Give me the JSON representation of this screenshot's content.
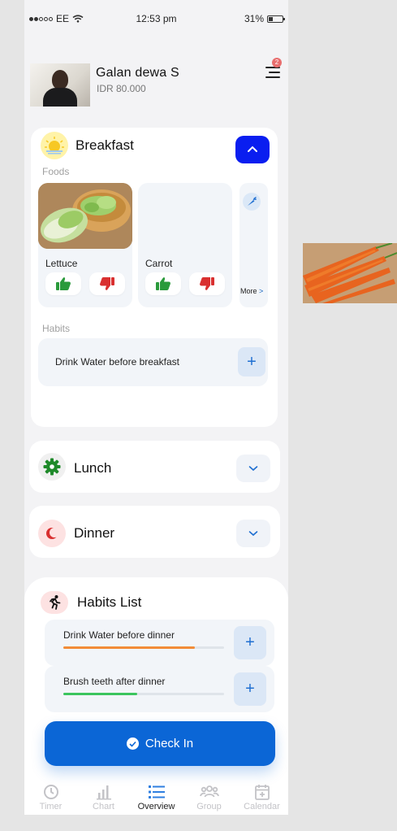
{
  "status": {
    "carrier": "EE",
    "time": "12:53 pm",
    "battery": "31%"
  },
  "profile": {
    "name": "Galan dewa S",
    "balance": "IDR 80.000",
    "notifications": "2"
  },
  "breakfast": {
    "title": "Breakfast",
    "foods_label": "Foods",
    "foods": [
      {
        "name": "Lettuce"
      },
      {
        "name": "Carrot"
      }
    ],
    "more_label": "More",
    "more_arrow": ">",
    "habits_label": "Habits",
    "habit": "Drink Water before breakfast",
    "plus": "+"
  },
  "lunch": {
    "title": "Lunch"
  },
  "dinner": {
    "title": "Dinner"
  },
  "habits_list": {
    "title": "Habits List",
    "items": [
      {
        "label": "Drink Water before dinner",
        "progress": 0.82,
        "color": "#f28c38"
      },
      {
        "label": "Brush teeth after dinner",
        "progress": 0.46,
        "color": "#3cc55e"
      }
    ],
    "plus": "+"
  },
  "checkin_label": "Check In",
  "tabs": [
    {
      "label": "Timer",
      "icon": "clock-icon"
    },
    {
      "label": "Chart",
      "icon": "bar-chart-icon"
    },
    {
      "label": "Overview",
      "icon": "list-icon",
      "active": true
    },
    {
      "label": "Group",
      "icon": "group-icon"
    },
    {
      "label": "Calendar",
      "icon": "calendar-icon"
    }
  ],
  "colors": {
    "primary": "#0b66d6",
    "danger": "#d93030",
    "success": "#2a9a3b"
  }
}
